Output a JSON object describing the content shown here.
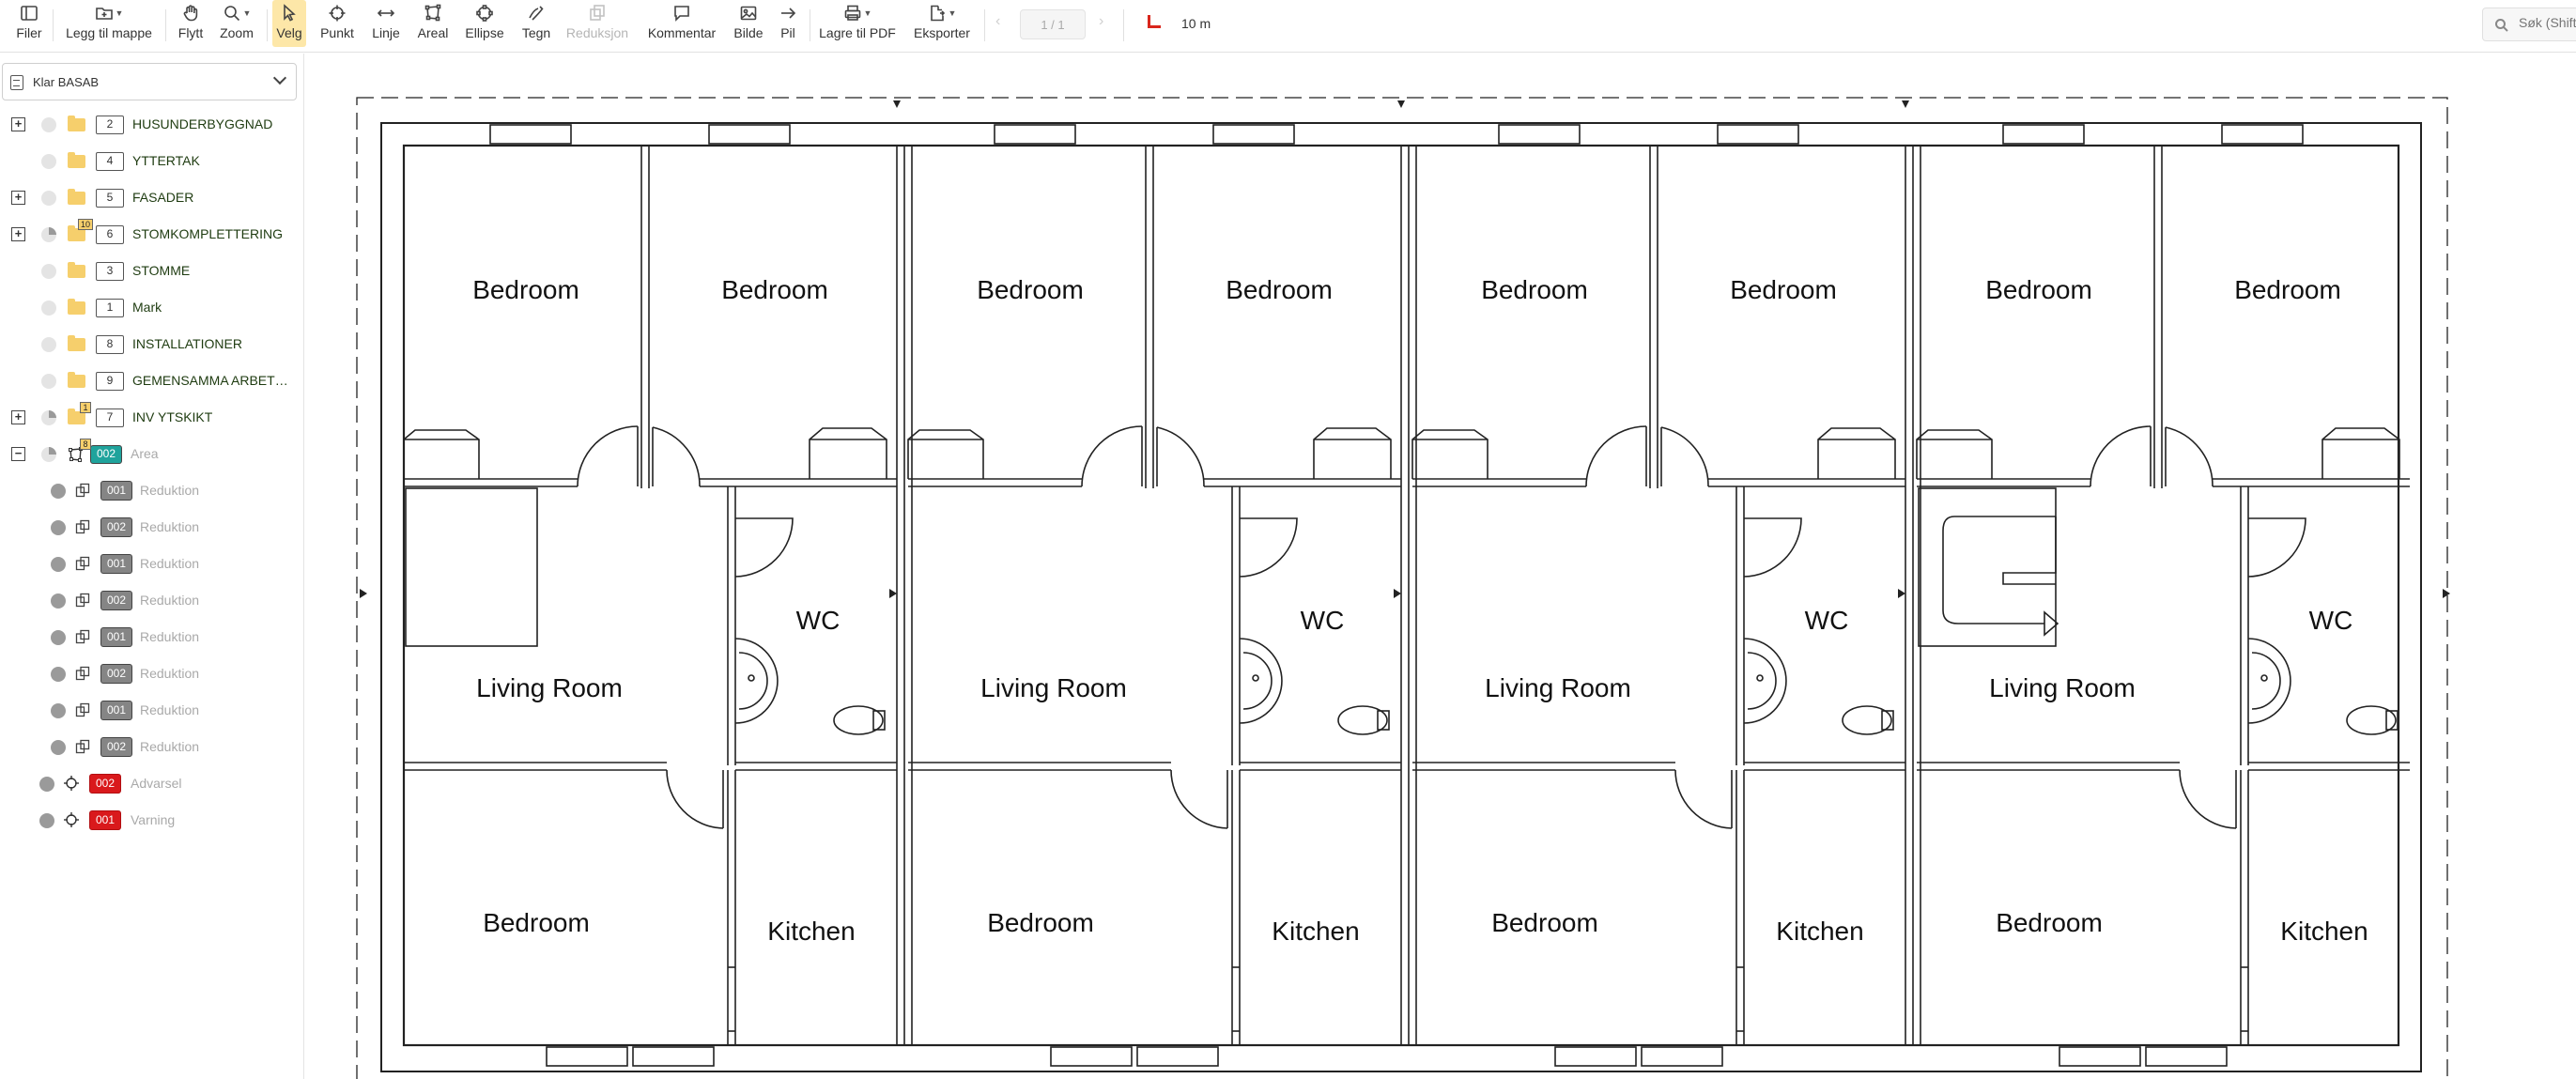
{
  "toolbar": {
    "items": [
      {
        "label": "Filer",
        "icon": "sidebar-icon"
      },
      {
        "label": "Legg til mappe",
        "icon": "add-folder-icon"
      },
      {
        "label": "Flytt",
        "icon": "hand-icon"
      },
      {
        "label": "Zoom",
        "icon": "magnifier-icon"
      },
      {
        "label": "Velg",
        "icon": "cursor-icon"
      },
      {
        "label": "Punkt",
        "icon": "point-icon"
      },
      {
        "label": "Linje",
        "icon": "line-icon"
      },
      {
        "label": "Areal",
        "icon": "area-icon"
      },
      {
        "label": "Ellipse",
        "icon": "ellipse-icon"
      },
      {
        "label": "Tegn",
        "icon": "pen-icon"
      },
      {
        "label": "Reduksjon",
        "icon": "reduction-icon"
      },
      {
        "label": "Kommentar",
        "icon": "comment-icon"
      },
      {
        "label": "Bilde",
        "icon": "image-icon"
      },
      {
        "label": "Pil",
        "icon": "arrow-icon"
      },
      {
        "label": "Lagre til PDF",
        "icon": "printer-icon"
      },
      {
        "label": "Eksporter",
        "icon": "export-icon"
      }
    ],
    "active_tool": "Velg",
    "disabled_tool": "Reduksjon",
    "page_indicator": "1 / 1",
    "scale_text": "10 m",
    "search_placeholder": "Søk (Shift"
  },
  "sidebar": {
    "project": "Klar BASAB",
    "folders": [
      {
        "number": "2",
        "label": "HUSUNDERBYGGNAD",
        "expandable": true
      },
      {
        "number": "4",
        "label": "YTTERTAK",
        "expandable": false
      },
      {
        "number": "5",
        "label": "FASADER",
        "expandable": true
      },
      {
        "number": "6",
        "label": "STOMKOMPLETTERING",
        "expandable": true,
        "count": "10"
      },
      {
        "number": "3",
        "label": "STOMME",
        "expandable": false
      },
      {
        "number": "1",
        "label": "Mark",
        "expandable": false
      },
      {
        "number": "8",
        "label": "INSTALLATIONER",
        "expandable": false
      },
      {
        "number": "9",
        "label": "GEMENSAMMA ARBETEN",
        "expandable": false
      },
      {
        "number": "7",
        "label": "INV YTSKIKT",
        "expandable": true,
        "count": "1"
      }
    ],
    "area_group": {
      "code": "002",
      "label": "Area",
      "count": "8",
      "expanded": true
    },
    "area_items": [
      {
        "code": "001",
        "label": "Reduktion"
      },
      {
        "code": "002",
        "label": "Reduktion"
      },
      {
        "code": "001",
        "label": "Reduktion"
      },
      {
        "code": "002",
        "label": "Reduktion"
      },
      {
        "code": "001",
        "label": "Reduktion"
      },
      {
        "code": "002",
        "label": "Reduktion"
      },
      {
        "code": "001",
        "label": "Reduktion"
      },
      {
        "code": "002",
        "label": "Reduktion"
      }
    ],
    "point_items": [
      {
        "code": "002",
        "label": "Advarsel"
      },
      {
        "code": "001",
        "label": "Varning"
      }
    ]
  },
  "plan": {
    "room_labels": {
      "bedroom": "Bedroom",
      "living": "Living Room",
      "wc": "WC",
      "kitchen": "Kitchen"
    },
    "unit_count": 4
  },
  "colors": {
    "active_tool_bg": "#fde7a8",
    "folder": "#f6cf6c",
    "area_badge": "#1fa39c",
    "warning_badge": "#d9191c",
    "reduction_badge": "#858585",
    "scale_marker": "#d9261c"
  }
}
